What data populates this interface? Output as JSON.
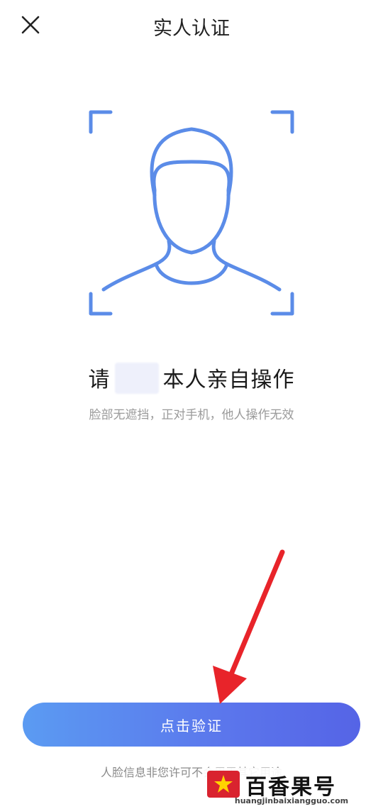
{
  "header": {
    "title": "实人认证",
    "close_icon": "close-icon"
  },
  "illustration": {
    "icon": "face-scan-icon",
    "color": "#5b8ce8"
  },
  "prompt": {
    "prefix": "请",
    "suffix": "本人亲自操作",
    "hint": "脸部无遮挡，正对手机，他人操作无效"
  },
  "actions": {
    "verify_label": "点击验证",
    "accent_start": "#5b9bf2",
    "accent_end": "#5564e6"
  },
  "footer": {
    "disclaimer": "人脸信息非您许可不会用于其它用途"
  },
  "watermark": {
    "brand": "百香果号",
    "url": "huangjinbaixiangguo.com"
  },
  "annotation": {
    "arrow_color": "#e8242a"
  }
}
